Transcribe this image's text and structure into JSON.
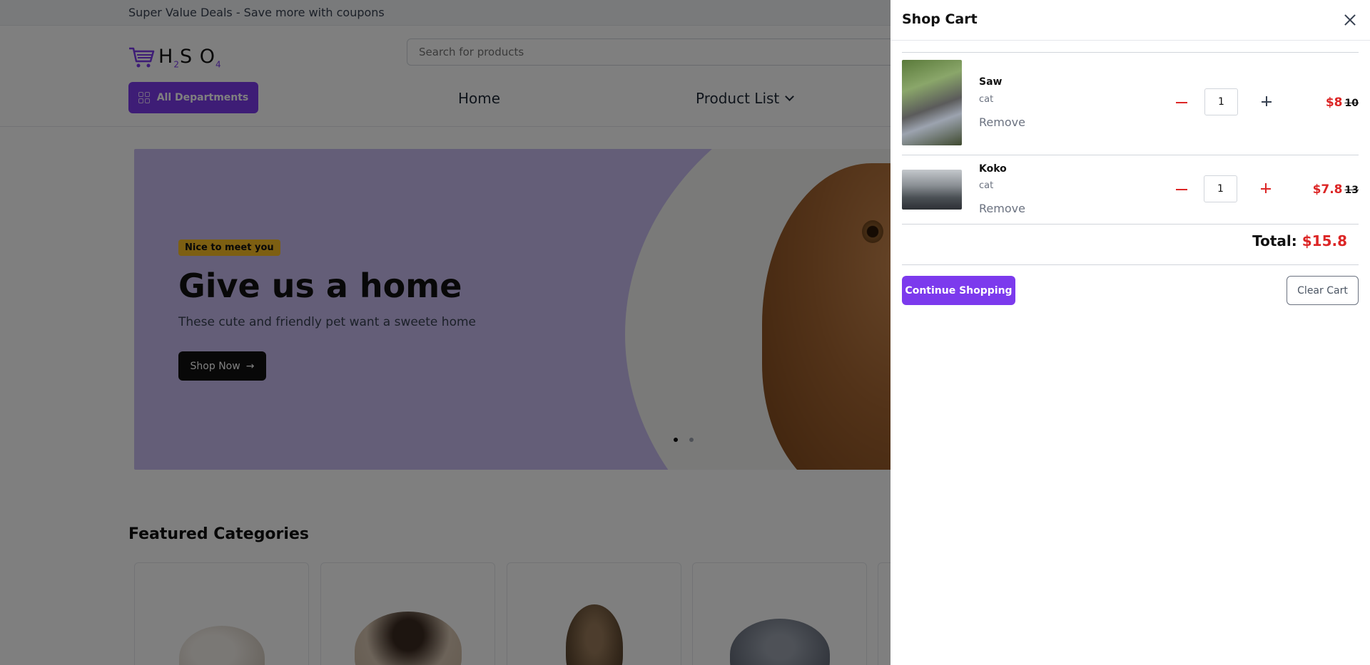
{
  "topbar": {
    "text": "Super Value Deals - Save more with coupons"
  },
  "header": {
    "logo": {
      "h": "H",
      "sub2": "2",
      "s": "S",
      "o": "O",
      "sub4": "4"
    },
    "search_placeholder": "Search for products",
    "departments_label": "All Departments",
    "nav": {
      "home": "Home",
      "product_list": "Product List"
    }
  },
  "hero": {
    "badge": "Nice to meet you",
    "title": "Give us a home",
    "subtitle": "These cute and friendly pet want a sweete home",
    "cta": "Shop Now",
    "cta_arrow": "→",
    "slides": 2,
    "active_slide": 1
  },
  "featured": {
    "title": "Featured Categories"
  },
  "cart": {
    "title": "Shop Cart",
    "items": [
      {
        "name": "Saw",
        "variant": "cat",
        "remove": "Remove",
        "qty": "1",
        "price": "$8",
        "old_price": "10"
      },
      {
        "name": "Koko",
        "variant": "cat",
        "remove": "Remove",
        "qty": "1",
        "price": "$7.8",
        "old_price": "13"
      }
    ],
    "total_label": "Total:",
    "total_value": "$15.8",
    "continue_label": "Continue Shopping",
    "clear_label": "Clear Cart"
  },
  "colors": {
    "accent": "#7c3aed",
    "price": "#dc2626",
    "badge": "#fbbf24"
  }
}
